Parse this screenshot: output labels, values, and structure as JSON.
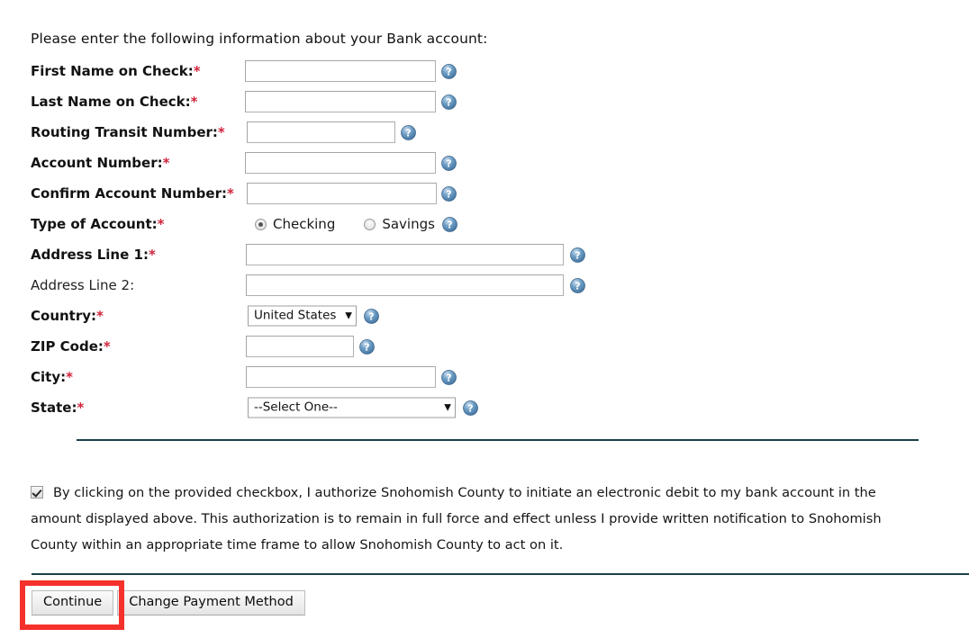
{
  "page": {
    "intro": "Please enter the following information about your Bank account:",
    "background_color": "#ffffff",
    "required_marker": "*",
    "required_color": "#d0243c",
    "divider_color": "#1c3f4a",
    "highlight_color": "#f5312c"
  },
  "fields": [
    {
      "label": "First Name on Check:",
      "required": true,
      "type": "text",
      "value": "",
      "placeholder": "",
      "help_icon": "help-question-icon"
    },
    {
      "label": "Last Name on Check:",
      "required": true,
      "type": "text",
      "value": "",
      "placeholder": "",
      "help_icon": "help-question-icon"
    },
    {
      "label": "Routing Transit Number:",
      "required": true,
      "type": "text",
      "value": "",
      "placeholder": "",
      "help_icon": "help-question-icon"
    },
    {
      "label": "Account Number:",
      "required": true,
      "type": "text",
      "value": "",
      "placeholder": "",
      "help_icon": "help-question-icon"
    },
    {
      "label": "Confirm Account Number:",
      "required": true,
      "type": "text",
      "value": "",
      "placeholder": "",
      "help_icon": "help-question-icon"
    },
    {
      "label": "Type of Account:",
      "required": true,
      "type": "radio",
      "options": [
        "Checking",
        "Savings"
      ],
      "selected": "Checking",
      "help_icon": "help-question-icon"
    },
    {
      "label": "Address Line 1:",
      "required": true,
      "type": "text",
      "value": "",
      "placeholder": "",
      "help_icon": "help-question-icon"
    },
    {
      "label": "Address Line 2:",
      "required": false,
      "type": "text",
      "value": "",
      "placeholder": "",
      "help_icon": "help-question-icon"
    },
    {
      "label": "Country:",
      "required": true,
      "type": "select",
      "value": "United States",
      "options": [
        "United States"
      ],
      "help_icon": "help-question-icon"
    },
    {
      "label": "ZIP Code:",
      "required": true,
      "type": "text",
      "value": "",
      "placeholder": "",
      "help_icon": "help-question-icon"
    },
    {
      "label": "City:",
      "required": true,
      "type": "text",
      "value": "",
      "placeholder": "",
      "help_icon": "help-question-icon"
    },
    {
      "label": "State:",
      "required": true,
      "type": "select",
      "value": "--Select One--",
      "options": [
        "--Select One--"
      ],
      "help_icon": "help-question-icon"
    }
  ],
  "authorization": {
    "checked": true,
    "text": "By clicking on the provided checkbox, I authorize Snohomish County to initiate an electronic debit to my bank account in the amount displayed above. This authorization is to remain in full force and effect unless I provide written notification to Snohomish County within an appropriate time frame to allow Snohomish County to act on it."
  },
  "buttons": {
    "continue": "Continue",
    "change_payment_method": "Change Payment Method",
    "highlighted": "Continue"
  }
}
